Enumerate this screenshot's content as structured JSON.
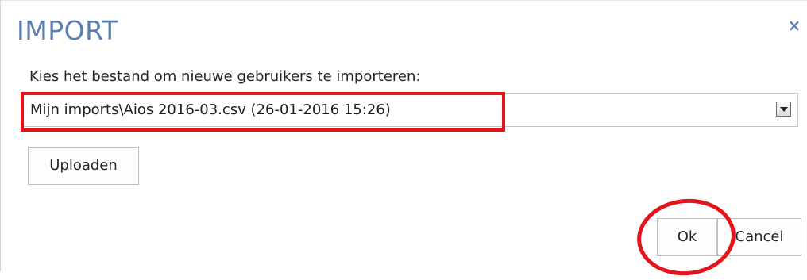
{
  "dialog": {
    "title": "IMPORT",
    "close_glyph": "×",
    "prompt": "Kies het bestand om nieuwe gebruikers te importeren:",
    "file_select": {
      "selected_value": "Mijn imports\\Aios 2016-03.csv (26-01-2016 15:26)"
    },
    "upload_label": "Uploaden",
    "ok_label": "Ok",
    "cancel_label": "Cancel"
  },
  "annotations": {
    "highlight_color": "#e3141c"
  },
  "colors": {
    "title": "#5b7fb0",
    "text": "#262626"
  },
  "icons": {
    "close": "close-icon",
    "dropdown": "chevron-down-icon"
  }
}
